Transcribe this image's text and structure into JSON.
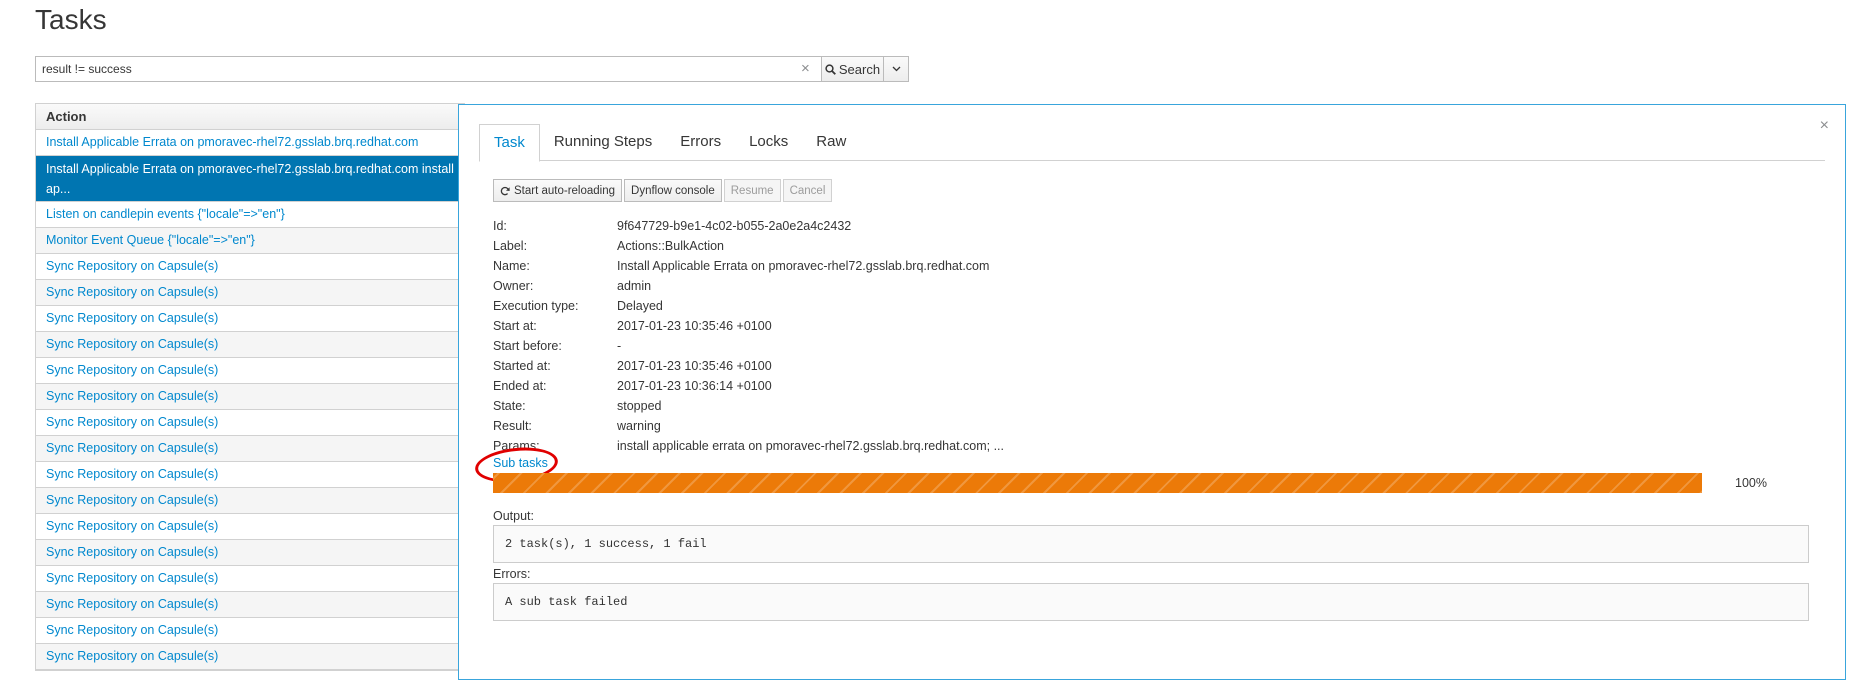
{
  "page": {
    "title": "Tasks"
  },
  "search": {
    "value": "result != success",
    "clear_glyph": "×",
    "button_label": "Search",
    "button_icon": "search-icon",
    "dropdown_icon": "caret-down-icon"
  },
  "table": {
    "header": "Action",
    "rows": [
      "Install Applicable Errata on pmoravec-rhel72.gsslab.brq.redhat.com",
      "Install Applicable Errata on pmoravec-rhel72.gsslab.brq.redhat.com install ap...",
      "Listen on candlepin events {\"locale\"=>\"en\"}",
      "Monitor Event Queue {\"locale\"=>\"en\"}",
      "Sync Repository on Capsule(s)",
      "Sync Repository on Capsule(s)",
      "Sync Repository on Capsule(s)",
      "Sync Repository on Capsule(s)",
      "Sync Repository on Capsule(s)",
      "Sync Repository on Capsule(s)",
      "Sync Repository on Capsule(s)",
      "Sync Repository on Capsule(s)",
      "Sync Repository on Capsule(s)",
      "Sync Repository on Capsule(s)",
      "Sync Repository on Capsule(s)",
      "Sync Repository on Capsule(s)",
      "Sync Repository on Capsule(s)",
      "Sync Repository on Capsule(s)",
      "Sync Repository on Capsule(s)",
      "Sync Repository on Capsule(s)"
    ],
    "selected_index": 1
  },
  "detail": {
    "close_glyph": "×",
    "tabs": [
      "Task",
      "Running Steps",
      "Errors",
      "Locks",
      "Raw"
    ],
    "active_tab": "Task",
    "buttons": {
      "auto_reload": "Start auto-reloading",
      "dynflow": "Dynflow console",
      "resume": "Resume",
      "cancel": "Cancel"
    },
    "properties": [
      {
        "key": "Id:",
        "value": "9f647729-b9e1-4c02-b055-2a0e2a4c2432"
      },
      {
        "key": "Label:",
        "value": "Actions::BulkAction"
      },
      {
        "key": "Name:",
        "value": "Install Applicable Errata on pmoravec-rhel72.gsslab.brq.redhat.com"
      },
      {
        "key": "Owner:",
        "value": "admin"
      },
      {
        "key": "Execution type:",
        "value": "Delayed"
      },
      {
        "key": "Start at:",
        "value": "2017-01-23 10:35:46 +0100"
      },
      {
        "key": "Start before:",
        "value": "-"
      },
      {
        "key": "Started at:",
        "value": "2017-01-23 10:35:46 +0100"
      },
      {
        "key": "Ended at:",
        "value": "2017-01-23 10:36:14 +0100"
      },
      {
        "key": "State:",
        "value": "stopped"
      },
      {
        "key": "Result:",
        "value": "warning"
      },
      {
        "key": "Params:",
        "value": "install applicable errata on pmoravec-rhel72.gsslab.brq.redhat.com; ..."
      }
    ],
    "sub_tasks_link": "Sub tasks",
    "progress": {
      "percent": 100,
      "label": "100%",
      "color": "#ec7a08"
    },
    "output_label": "Output:",
    "output_value": "2 task(s), 1 success, 1 fail",
    "errors_label": "Errors:",
    "errors_value": "A sub task failed"
  },
  "colors": {
    "link": "#0088ce",
    "selected_row": "#0075b1",
    "highlight_circle": "#e00000"
  }
}
